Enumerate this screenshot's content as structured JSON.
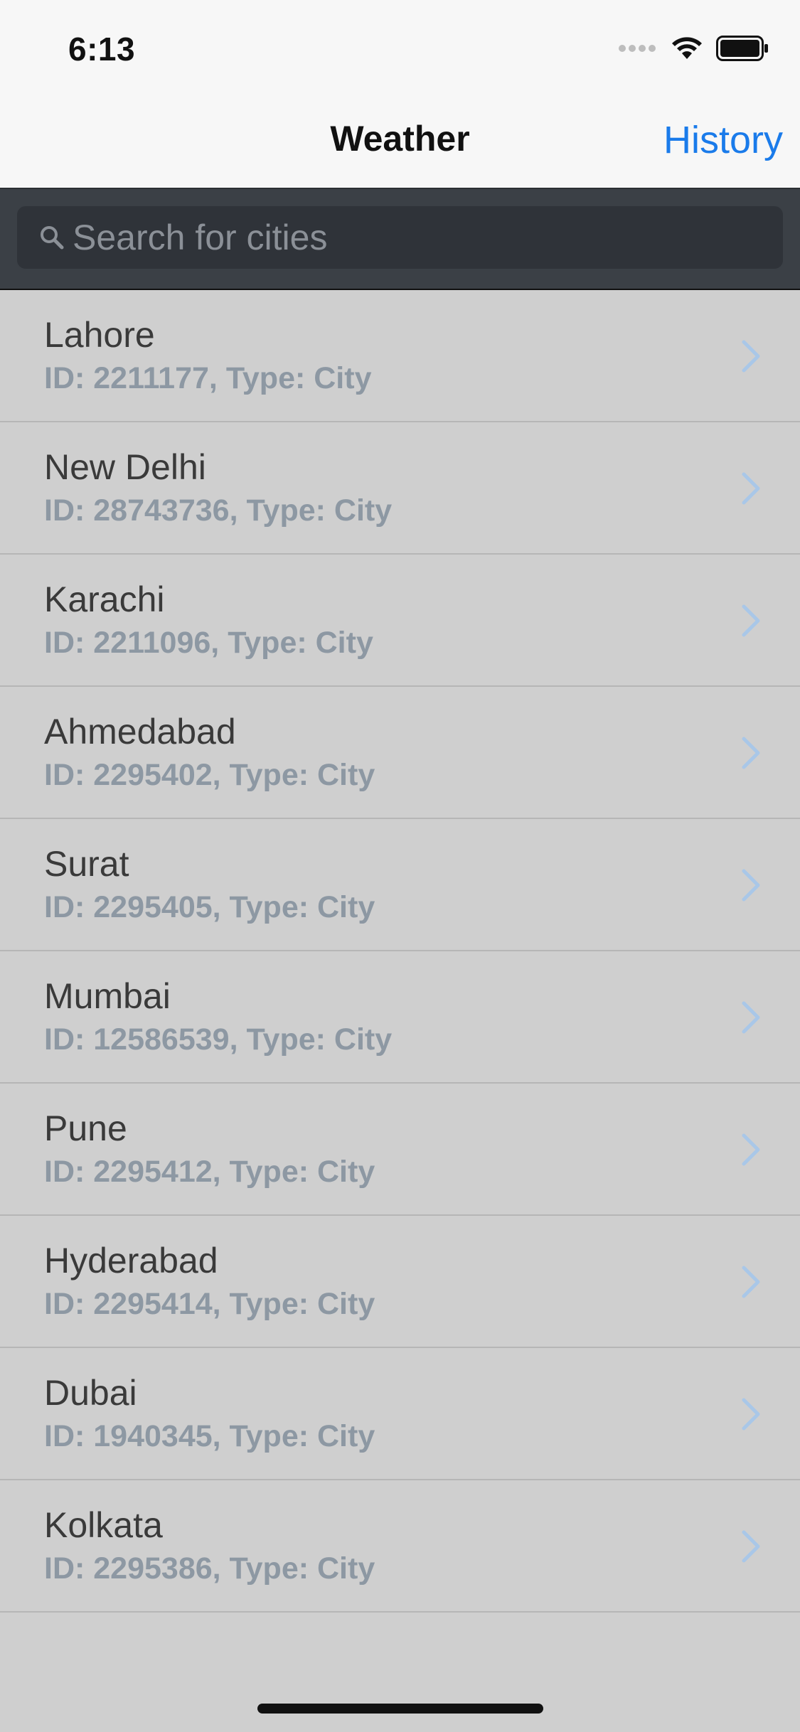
{
  "status_bar": {
    "time": "6:13",
    "icons": [
      "signal-dots-icon",
      "wifi-icon",
      "battery-icon"
    ]
  },
  "nav": {
    "title": "Weather",
    "history_label": "History"
  },
  "search": {
    "placeholder": "Search for cities",
    "value": ""
  },
  "cities": [
    {
      "name": "Lahore",
      "subtitle": "ID: 2211177, Type: City"
    },
    {
      "name": "New Delhi",
      "subtitle": "ID: 28743736, Type: City"
    },
    {
      "name": "Karachi",
      "subtitle": "ID: 2211096, Type: City"
    },
    {
      "name": "Ahmedabad",
      "subtitle": "ID: 2295402, Type: City"
    },
    {
      "name": "Surat",
      "subtitle": "ID: 2295405, Type: City"
    },
    {
      "name": "Mumbai",
      "subtitle": "ID: 12586539, Type: City"
    },
    {
      "name": "Pune",
      "subtitle": "ID: 2295412, Type: City"
    },
    {
      "name": "Hyderabad",
      "subtitle": "ID: 2295414, Type: City"
    },
    {
      "name": "Dubai",
      "subtitle": "ID: 1940345, Type: City"
    },
    {
      "name": "Kolkata",
      "subtitle": "ID: 2295386, Type: City"
    }
  ],
  "colors": {
    "accent": "#1a7bea",
    "list_background": "#cfcfcf",
    "search_background": "#3b4046",
    "subtitle": "#8d98a3",
    "chevron": "#a9c7e8"
  }
}
